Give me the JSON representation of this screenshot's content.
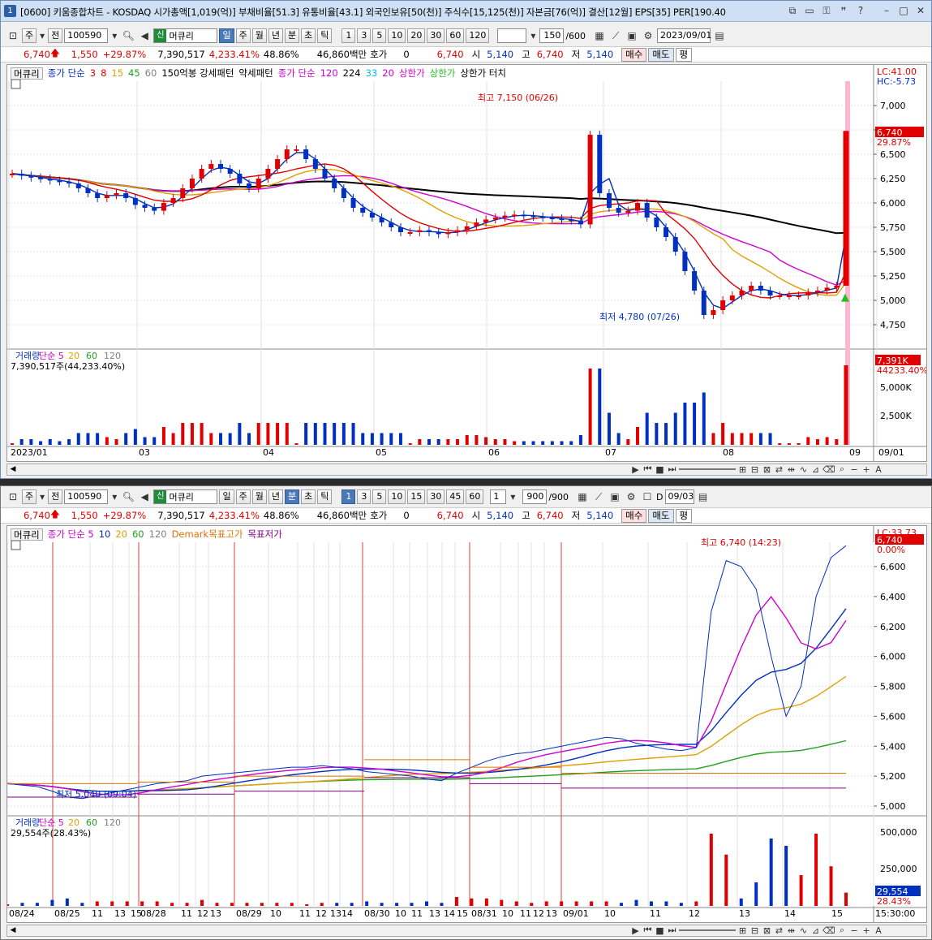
{
  "top": {
    "title": "[0600] 키움종합차트 - KOSDAQ 시가총액[1,019(억)] 부채비율[51.3] 유통비율[43.1] 외국인보유[50(천)] 주식수[15,125(천)] 자본금[76(억)] 결산[12월] EPS[35] PER[190.40",
    "window_icon": "1",
    "toolbar": {
      "type_sel": "주",
      "prev_btn": "전",
      "code": "100590",
      "stock_name": "머큐리",
      "shin": "신",
      "periods": [
        "일",
        "주",
        "월",
        "년",
        "분",
        "초",
        "틱"
      ],
      "active_period": "일",
      "intervals": [
        "1",
        "3",
        "5",
        "10",
        "20",
        "30",
        "60",
        "120"
      ],
      "count": "150",
      "total": "/600",
      "date": "2023/09/01"
    },
    "info": {
      "price": "6,740",
      "change": "1,550",
      "rate": "+29.87%",
      "volume": "7,390,517",
      "vol_rate": "4,233.41%",
      "turnover": "48.86%",
      "amount": "46,860백만",
      "hoga_label": "호가",
      "hoga": "0",
      "hoga_price": "6,740",
      "open_label": "시",
      "open": "5,140",
      "high_label": "고",
      "high": "6,740",
      "low_label": "저",
      "low": "5,140",
      "buy": "매수",
      "sell": "매도",
      "avg": "평"
    },
    "legend": [
      {
        "t": "머큐리",
        "c": "#000000",
        "box": true
      },
      {
        "t": "종가 단순",
        "c": "#0030c0"
      },
      {
        "t": "3",
        "c": "#e00000"
      },
      {
        "t": "8",
        "c": "#e00000"
      },
      {
        "t": "15",
        "c": "#e0a000"
      },
      {
        "t": "45",
        "c": "#20a020"
      },
      {
        "t": "60",
        "c": "#808080"
      },
      {
        "t": "150억봉 강세패턴",
        "c": "#000000"
      },
      {
        "t": "약세패턴",
        "c": "#000000"
      },
      {
        "t": "종가 단순",
        "c": "#d000d0"
      },
      {
        "t": "120",
        "c": "#d000d0"
      },
      {
        "t": "224",
        "c": "#000000"
      },
      {
        "t": "33",
        "c": "#00c0e0"
      },
      {
        "t": "20",
        "c": "#d000d0"
      },
      {
        "t": "상한가",
        "c": "#d000d0"
      },
      {
        "t": "상한가",
        "c": "#20c020"
      },
      {
        "t": "상한가 터치",
        "c": "#000000"
      }
    ],
    "chart_data": {
      "type": "candlestick",
      "y_ticks": [
        "7,000",
        "6,750",
        "6,500",
        "6,250",
        "6,000",
        "5,750",
        "5,500",
        "5,250",
        "5,000",
        "4,750"
      ],
      "x_ticks": [
        "2023/01",
        "03",
        "04",
        "05",
        "06",
        "07",
        "08",
        "09",
        "09/01"
      ],
      "max_label": "최고 7,150 (06/26)",
      "min_label": "최저 4,780 (07/26)",
      "lc": "LC:41.00",
      "hc": "HC:-5.73",
      "last_price": "6,740",
      "last_rate": "29.87%",
      "close_series": [
        6300,
        6280,
        6260,
        6250,
        6230,
        6220,
        6200,
        6150,
        6100,
        6050,
        6080,
        6100,
        6050,
        5980,
        5950,
        5920,
        6000,
        6050,
        6150,
        6250,
        6350,
        6400,
        6350,
        6300,
        6200,
        6150,
        6250,
        6350,
        6450,
        6550,
        6550,
        6450,
        6350,
        6250,
        6150,
        6050,
        5950,
        5900,
        5850,
        5800,
        5750,
        5700,
        5700,
        5720,
        5700,
        5680,
        5700,
        5720,
        5760,
        5800,
        5830,
        5850,
        5870,
        5880,
        5870,
        5860,
        5850,
        5840,
        5830,
        5820,
        5780,
        6700,
        6100,
        5950,
        5900,
        5920,
        6000,
        5850,
        5750,
        5650,
        5500,
        5300,
        5100,
        4850,
        4900,
        5000,
        5050,
        5100,
        5150,
        5100,
        5050,
        5050,
        5050,
        5050,
        5080,
        5100,
        5130,
        5150,
        6740
      ],
      "vol_ticks": [
        "5,000K",
        "2,500K"
      ],
      "vol_label": "7,390,517주(44,233.40%)",
      "vol_legend": [
        {
          "t": "거래량",
          "c": "#0030c0"
        },
        {
          "t": "단순 5",
          "c": "#d000d0"
        },
        {
          "t": "20",
          "c": "#e0a000"
        },
        {
          "t": "60",
          "c": "#20a020"
        },
        {
          "t": "120",
          "c": "#808080"
        }
      ],
      "vol_last": "7,391K",
      "vol_last_rate": "44233.40%"
    }
  },
  "bottom": {
    "window_icon": "1",
    "toolbar": {
      "type_sel": "주",
      "prev_btn": "전",
      "code": "100590",
      "stock_name": "머큐리",
      "shin": "신",
      "periods": [
        "일",
        "주",
        "월",
        "년",
        "분",
        "초",
        "틱"
      ],
      "active_period": "분",
      "intervals": [
        "1",
        "3",
        "5",
        "10",
        "15",
        "30",
        "45",
        "60"
      ],
      "count_sel": "1",
      "count": "900",
      "total": "/900",
      "d_label": "D",
      "date": "09/03"
    },
    "info": {
      "price": "6,740",
      "change": "1,550",
      "rate": "+29.87%",
      "volume": "7,390,517",
      "vol_rate": "4,233.41%",
      "turnover": "48.86%",
      "amount": "46,860백만",
      "hoga_label": "호가",
      "hoga": "0",
      "hoga_price": "6,740",
      "open_label": "시",
      "open": "5,140",
      "high_label": "고",
      "high": "6,740",
      "low_label": "저",
      "low": "5,140",
      "buy": "매수",
      "sell": "매도",
      "avg": "평"
    },
    "legend": [
      {
        "t": "머큐리",
        "c": "#000000",
        "box": true
      },
      {
        "t": "종가 단순 5",
        "c": "#d000d0"
      },
      {
        "t": "10",
        "c": "#0030c0"
      },
      {
        "t": "20",
        "c": "#e0a000"
      },
      {
        "t": "60",
        "c": "#20a020"
      },
      {
        "t": "120",
        "c": "#808080"
      },
      {
        "t": "Demark목표고가",
        "c": "#e07000"
      },
      {
        "t": "목표저가",
        "c": "#800080"
      }
    ],
    "chart_data": {
      "type": "line",
      "y_ticks": [
        "6,600",
        "6,400",
        "6,200",
        "6,000",
        "5,800",
        "5,600",
        "5,400",
        "5,200",
        "5,000"
      ],
      "x_ticks": [
        "08/24",
        "08/25",
        "11",
        "13",
        "15",
        "08/28",
        "11",
        "12",
        "13",
        "08/29",
        "10",
        "11",
        "12",
        "13",
        "14",
        "08/30",
        "10",
        "11",
        "13",
        "14",
        "15",
        "08/31",
        "10",
        "11",
        "12",
        "13",
        "09/01",
        "10",
        "11",
        "12",
        "13",
        "14",
        "15",
        "15:30:00"
      ],
      "max_label": "최고 6,740 (14:23)",
      "min_label": "최저 5,040 (09:04)",
      "lc": "LC:33.73",
      "last_price": "6,740",
      "last_rate": "0.00%",
      "close_series": [
        5150,
        5140,
        5130,
        5100,
        5060,
        5050,
        5070,
        5090,
        5110,
        5130,
        5150,
        5160,
        5170,
        5200,
        5210,
        5220,
        5230,
        5240,
        5250,
        5260,
        5260,
        5270,
        5260,
        5250,
        5230,
        5220,
        5210,
        5200,
        5180,
        5170,
        5220,
        5260,
        5300,
        5330,
        5350,
        5360,
        5380,
        5400,
        5420,
        5440,
        5460,
        5450,
        5420,
        5400,
        5380,
        5370,
        5390,
        6300,
        6640,
        6600,
        6450,
        6000,
        5600,
        5800,
        6400,
        6660,
        6740
      ],
      "vol_ticks": [
        "500,000",
        "250,000"
      ],
      "vol_label": "29,554주(28.43%)",
      "vol_legend": [
        {
          "t": "거래량",
          "c": "#0030c0"
        },
        {
          "t": "단순 5",
          "c": "#d000d0"
        },
        {
          "t": "20",
          "c": "#e0a000"
        },
        {
          "t": "60",
          "c": "#20a020"
        },
        {
          "t": "120",
          "c": "#808080"
        }
      ],
      "vol_last": "29,554",
      "vol_last_rate": "28.43%"
    }
  }
}
